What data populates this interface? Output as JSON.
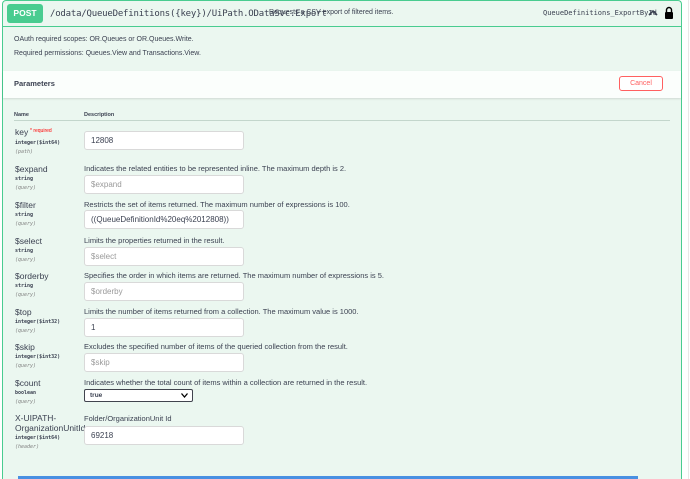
{
  "summary": {
    "method": "POST",
    "path": "/odata/QueueDefinitions({key})/UiPath.ODataSvc.Export",
    "description": "Requests a CSV export of filtered items.",
    "operation_id": "QueueDefinitions_ExportById",
    "method_color": "#49cc90"
  },
  "info": {
    "scopes": "OAuth required scopes: OR.Queues or OR.Queues.Write.",
    "permissions": "Required permissions: Queues.View and Transactions.View."
  },
  "parameters": {
    "title": "Parameters",
    "cancel_label": "Cancel",
    "col_name": "Name",
    "col_description": "Description",
    "required_label": "* required",
    "items": [
      {
        "name": "key",
        "type": "integer($int64)",
        "in": "(path)",
        "required": true,
        "description": "",
        "value": "12808",
        "placeholder": ""
      },
      {
        "name": "$expand",
        "type": "string",
        "in": "(query)",
        "description": "Indicates the related entities to be represented inline. The maximum depth is 2.",
        "value": "",
        "placeholder": "$expand"
      },
      {
        "name": "$filter",
        "type": "string",
        "in": "(query)",
        "description": "Restricts the set of items returned. The maximum number of expressions is 100.",
        "value": "((QueueDefinitionId%20eq%2012808))",
        "placeholder": ""
      },
      {
        "name": "$select",
        "type": "string",
        "in": "(query)",
        "description": "Limits the properties returned in the result.",
        "value": "",
        "placeholder": "$select"
      },
      {
        "name": "$orderby",
        "type": "string",
        "in": "(query)",
        "description": "Specifies the order in which items are returned. The maximum number of expressions is 5.",
        "value": "",
        "placeholder": "$orderby"
      },
      {
        "name": "$top",
        "type": "integer($int32)",
        "in": "(query)",
        "description": "Limits the number of items returned from a collection. The maximum value is 1000.",
        "value": "1",
        "placeholder": ""
      },
      {
        "name": "$skip",
        "type": "integer($int32)",
        "in": "(query)",
        "description": "Excludes the specified number of items of the queried collection from the result.",
        "value": "",
        "placeholder": "$skip"
      },
      {
        "name": "$count",
        "type": "boolean",
        "in": "(query)",
        "description": "Indicates whether the total count of items within a collection are returned in the result.",
        "value": "true",
        "placeholder": ""
      },
      {
        "name_line1": "X-UIPATH-",
        "name_line2": "OrganizationUnitId",
        "type": "integer($int64)",
        "in": "(header)",
        "description": "Folder/OrganizationUnit Id",
        "value": "69218",
        "placeholder": ""
      }
    ]
  },
  "icons": {
    "chevron": "chevron-up-icon",
    "lock": "lock-icon",
    "select_arrow": "chevron-down-icon"
  },
  "colors": {
    "accent": "#49cc90",
    "cancel": "#ff6060",
    "background": "#ebf7f0"
  }
}
